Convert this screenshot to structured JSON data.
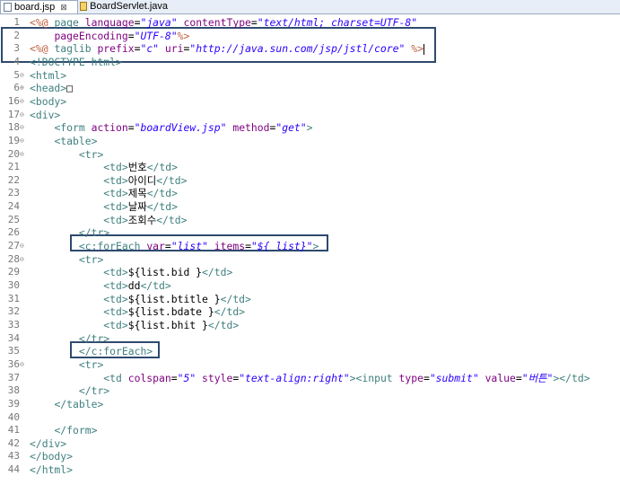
{
  "tabs": [
    {
      "label": "board.jsp",
      "close": "⊠"
    },
    {
      "label": "BoardServlet.java"
    }
  ],
  "lines": [
    {
      "n": "1",
      "f": "",
      "t": [
        [
          "jsp",
          "<%@ "
        ],
        [
          "tag",
          "page "
        ],
        [
          "attr",
          "language"
        ],
        [
          "txt",
          "="
        ],
        [
          "val",
          "\"java\""
        ],
        [
          "txt",
          " "
        ],
        [
          "attr",
          "contentType"
        ],
        [
          "txt",
          "="
        ],
        [
          "val",
          "\"text/html; charset=UTF-8\""
        ]
      ]
    },
    {
      "n": "2",
      "f": "",
      "t": [
        [
          "txt",
          "    "
        ],
        [
          "attr",
          "pageEncoding"
        ],
        [
          "txt",
          "="
        ],
        [
          "val",
          "\"UTF-8\""
        ],
        [
          "jsp",
          "%>"
        ]
      ]
    },
    {
      "n": "3",
      "f": "",
      "t": [
        [
          "jsp",
          "<%@ "
        ],
        [
          "tag",
          "taglib "
        ],
        [
          "attr",
          "prefix"
        ],
        [
          "txt",
          "="
        ],
        [
          "val",
          "\"c\""
        ],
        [
          "txt",
          " "
        ],
        [
          "attr",
          "uri"
        ],
        [
          "txt",
          "="
        ],
        [
          "val",
          "\"http://java.sun.com/jsp/jstl/core\""
        ],
        [
          "txt",
          " "
        ],
        [
          "jsp",
          "%>"
        ]
      ]
    },
    {
      "n": "4",
      "f": "",
      "t": [
        [
          "tag",
          "<!DOCTYPE html>"
        ]
      ]
    },
    {
      "n": "5",
      "f": "⊖",
      "t": [
        [
          "tag",
          "<html>"
        ]
      ]
    },
    {
      "n": "6",
      "f": "⊕",
      "t": [
        [
          "tag",
          "<head>"
        ],
        [
          "txt",
          "□"
        ]
      ]
    },
    {
      "n": "16",
      "f": "⊖",
      "t": [
        [
          "tag",
          "<body>"
        ]
      ]
    },
    {
      "n": "17",
      "f": "⊖",
      "t": [
        [
          "tag",
          "<div>"
        ]
      ]
    },
    {
      "n": "18",
      "f": "⊖",
      "t": [
        [
          "txt",
          "    "
        ],
        [
          "tag",
          "<form "
        ],
        [
          "attr",
          "action"
        ],
        [
          "txt",
          "="
        ],
        [
          "val",
          "\"boardView.jsp\""
        ],
        [
          "txt",
          " "
        ],
        [
          "attr",
          "method"
        ],
        [
          "txt",
          "="
        ],
        [
          "val",
          "\"get\""
        ],
        [
          "tag",
          ">"
        ]
      ]
    },
    {
      "n": "19",
      "f": "⊖",
      "t": [
        [
          "txt",
          "    "
        ],
        [
          "tag",
          "<table>"
        ]
      ]
    },
    {
      "n": "20",
      "f": "⊖",
      "t": [
        [
          "txt",
          "        "
        ],
        [
          "tag",
          "<tr>"
        ]
      ]
    },
    {
      "n": "21",
      "f": "",
      "t": [
        [
          "txt",
          "            "
        ],
        [
          "tag",
          "<td>"
        ],
        [
          "txt",
          "번호"
        ],
        [
          "tag",
          "</td>"
        ]
      ]
    },
    {
      "n": "22",
      "f": "",
      "t": [
        [
          "txt",
          "            "
        ],
        [
          "tag",
          "<td>"
        ],
        [
          "txt",
          "아이디"
        ],
        [
          "tag",
          "</td>"
        ]
      ]
    },
    {
      "n": "23",
      "f": "",
      "t": [
        [
          "txt",
          "            "
        ],
        [
          "tag",
          "<td>"
        ],
        [
          "txt",
          "제목"
        ],
        [
          "tag",
          "</td>"
        ]
      ]
    },
    {
      "n": "24",
      "f": "",
      "t": [
        [
          "txt",
          "            "
        ],
        [
          "tag",
          "<td>"
        ],
        [
          "txt",
          "날짜"
        ],
        [
          "tag",
          "</td>"
        ]
      ]
    },
    {
      "n": "25",
      "f": "",
      "t": [
        [
          "txt",
          "            "
        ],
        [
          "tag",
          "<td>"
        ],
        [
          "txt",
          "조회수"
        ],
        [
          "tag",
          "</td>"
        ]
      ]
    },
    {
      "n": "26",
      "f": "",
      "t": [
        [
          "txt",
          "        "
        ],
        [
          "tag",
          "</tr>"
        ]
      ]
    },
    {
      "n": "27",
      "f": "⊖",
      "t": [
        [
          "txt",
          "        "
        ],
        [
          "tag",
          "<c:forEach "
        ],
        [
          "attr",
          "var"
        ],
        [
          "txt",
          "="
        ],
        [
          "val",
          "\"list\""
        ],
        [
          "txt",
          " "
        ],
        [
          "attr",
          "items"
        ],
        [
          "txt",
          "="
        ],
        [
          "val",
          "\"${ list}\""
        ],
        [
          "tag",
          ">"
        ]
      ]
    },
    {
      "n": "28",
      "f": "⊖",
      "t": [
        [
          "txt",
          "        "
        ],
        [
          "tag",
          "<tr>"
        ]
      ]
    },
    {
      "n": "29",
      "f": "",
      "t": [
        [
          "txt",
          "            "
        ],
        [
          "tag",
          "<td>"
        ],
        [
          "txt",
          "${list.bid }"
        ],
        [
          "tag",
          "</td>"
        ]
      ]
    },
    {
      "n": "30",
      "f": "",
      "t": [
        [
          "txt",
          "            "
        ],
        [
          "tag",
          "<td>"
        ],
        [
          "txt",
          "dd"
        ],
        [
          "tag",
          "</td>"
        ]
      ]
    },
    {
      "n": "31",
      "f": "",
      "t": [
        [
          "txt",
          "            "
        ],
        [
          "tag",
          "<td>"
        ],
        [
          "txt",
          "${list.btitle }"
        ],
        [
          "tag",
          "</td>"
        ]
      ]
    },
    {
      "n": "32",
      "f": "",
      "t": [
        [
          "txt",
          "            "
        ],
        [
          "tag",
          "<td>"
        ],
        [
          "txt",
          "${list.bdate }"
        ],
        [
          "tag",
          "</td>"
        ]
      ]
    },
    {
      "n": "33",
      "f": "",
      "t": [
        [
          "txt",
          "            "
        ],
        [
          "tag",
          "<td>"
        ],
        [
          "txt",
          "${list.bhit }"
        ],
        [
          "tag",
          "</td>"
        ]
      ]
    },
    {
      "n": "34",
      "f": "",
      "t": [
        [
          "txt",
          "        "
        ],
        [
          "tag",
          "</tr>"
        ]
      ]
    },
    {
      "n": "35",
      "f": "",
      "t": [
        [
          "txt",
          "        "
        ],
        [
          "tag",
          "</c:forEach>"
        ]
      ]
    },
    {
      "n": "36",
      "f": "⊖",
      "t": [
        [
          "txt",
          "        "
        ],
        [
          "tag",
          "<tr>"
        ]
      ]
    },
    {
      "n": "37",
      "f": "",
      "t": [
        [
          "txt",
          "            "
        ],
        [
          "tag",
          "<td "
        ],
        [
          "attr",
          "colspan"
        ],
        [
          "txt",
          "="
        ],
        [
          "val",
          "\"5\""
        ],
        [
          "txt",
          " "
        ],
        [
          "attr",
          "style"
        ],
        [
          "txt",
          "="
        ],
        [
          "val",
          "\"text-align:right\""
        ],
        [
          "tag",
          "><input "
        ],
        [
          "attr",
          "type"
        ],
        [
          "txt",
          "="
        ],
        [
          "val",
          "\"submit\""
        ],
        [
          "txt",
          " "
        ],
        [
          "attr",
          "value"
        ],
        [
          "txt",
          "="
        ],
        [
          "val",
          "\"버튼\""
        ],
        [
          "tag",
          "></td>"
        ]
      ]
    },
    {
      "n": "38",
      "f": "",
      "t": [
        [
          "txt",
          "        "
        ],
        [
          "tag",
          "</tr>"
        ]
      ]
    },
    {
      "n": "39",
      "f": "",
      "t": [
        [
          "txt",
          "    "
        ],
        [
          "tag",
          "</table>"
        ]
      ]
    },
    {
      "n": "40",
      "f": "",
      "t": []
    },
    {
      "n": "41",
      "f": "",
      "t": [
        [
          "txt",
          "    "
        ],
        [
          "tag",
          "</form>"
        ]
      ]
    },
    {
      "n": "42",
      "f": "",
      "t": [
        [
          "tag",
          "</div>"
        ]
      ]
    },
    {
      "n": "43",
      "f": "",
      "t": [
        [
          "tag",
          "</body>"
        ]
      ]
    },
    {
      "n": "44",
      "f": "",
      "t": [
        [
          "tag",
          "</html>"
        ]
      ]
    }
  ]
}
